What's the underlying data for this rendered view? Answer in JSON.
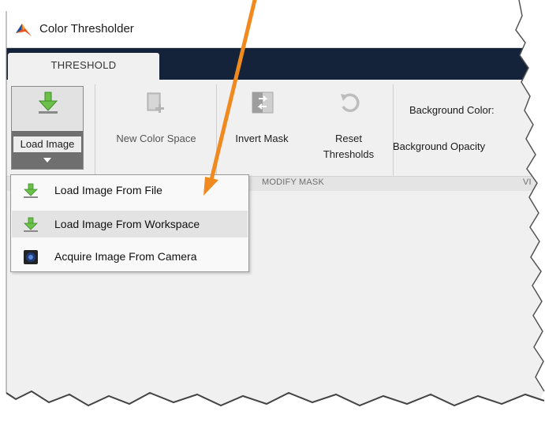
{
  "window": {
    "title": "Color Thresholder"
  },
  "tabs": [
    {
      "label": "THRESHOLD",
      "active": true
    }
  ],
  "toolstrip": {
    "load_image": {
      "label": "Load Image"
    },
    "new_color_space": {
      "label": "New Color Space"
    },
    "invert_mask": {
      "label": "Invert Mask"
    },
    "reset_thresholds": {
      "label_line1": "Reset",
      "label_line2": "Thresholds"
    },
    "background_color_label": "Background Color:",
    "background_opacity_label": "Background Opacity",
    "sections": {
      "modify_mask": "MODIFY MASK",
      "view_truncated": "VI"
    }
  },
  "load_menu": {
    "items": [
      {
        "label": "Load Image From File",
        "icon": "download-arrow-icon",
        "highlighted": false
      },
      {
        "label": "Load Image From Workspace",
        "icon": "download-arrow-icon",
        "highlighted": true
      },
      {
        "label": "Acquire Image From Camera",
        "icon": "camera-icon",
        "highlighted": false
      }
    ]
  },
  "colors": {
    "tabstrip": "#14233a",
    "toolstrip": "#f0f0f0",
    "annotation_arrow": "#f08a1f",
    "download_icon_green": "#6cc04a",
    "matlab_logo_orange": "#e65a1e"
  }
}
